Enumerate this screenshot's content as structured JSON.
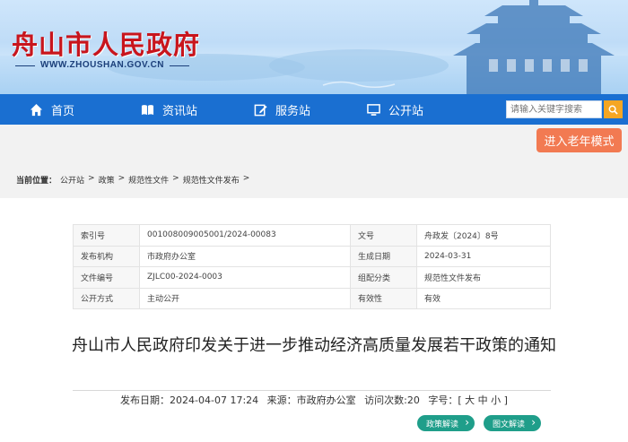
{
  "header": {
    "site_title": "舟山市人民政府",
    "site_url": "WWW.ZHOUSHAN.GOV.CN"
  },
  "nav": {
    "items": [
      {
        "label": "首页",
        "icon": "home-icon"
      },
      {
        "label": "资讯站",
        "icon": "book-icon"
      },
      {
        "label": "服务站",
        "icon": "edit-icon"
      },
      {
        "label": "公开站",
        "icon": "monitor-icon"
      }
    ],
    "search_placeholder": "请输入关键字搜索"
  },
  "elder_mode_label": "进入老年模式",
  "breadcrumb": {
    "prefix": "当前位置：",
    "items": [
      "公开站",
      "政策",
      "规范性文件",
      "规范性文件发布"
    ],
    "separator": ">"
  },
  "info_table": [
    {
      "k1": "索引号",
      "v1": "001008009005001/2024-00083",
      "k2": "文号",
      "v2": "舟政发〔2024〕8号"
    },
    {
      "k1": "发布机构",
      "v1": "市政府办公室",
      "k2": "生成日期",
      "v2": "2024-03-31"
    },
    {
      "k1": "文件编号",
      "v1": "ZJLC00-2024-0003",
      "k2": "组配分类",
      "v2": "规范性文件发布"
    },
    {
      "k1": "公开方式",
      "v1": "主动公开",
      "k2": "有效性",
      "v2": "有效"
    }
  ],
  "document": {
    "title": "舟山市人民政府印发关于进一步推动经济高质量发展若干政策的通知",
    "publish_date": "发布日期：2024-04-07 17:24",
    "source": "来源：市政府办公室",
    "visits": "访问次数:20",
    "font_size": "字号：[ 大 中 小 ]"
  },
  "buttons": {
    "policy_interpretation": "政策解读",
    "graphic_interpretation": "图文解读"
  },
  "colors": {
    "nav_blue": "#1a6fd1",
    "title_red": "#c8151d",
    "elder_orange": "#f27a52",
    "search_orange": "#f5a623",
    "pill_teal": "#1f9e8a"
  }
}
